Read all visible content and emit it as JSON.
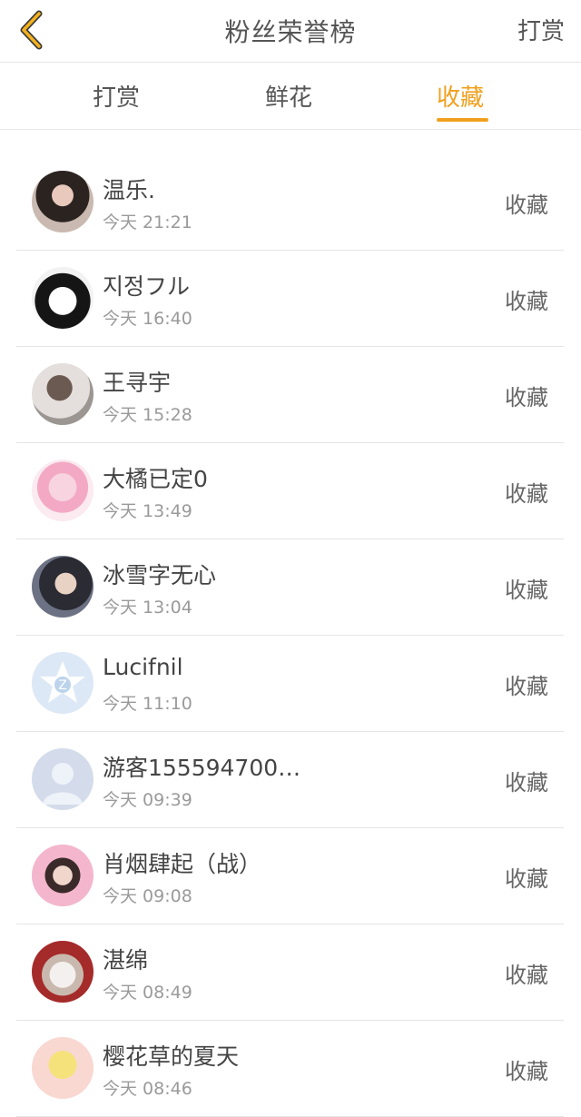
{
  "header": {
    "title": "粉丝荣誉榜",
    "action_label": "打赏"
  },
  "tabs": [
    {
      "label": "打赏",
      "active": false
    },
    {
      "label": "鲜花",
      "active": false
    },
    {
      "label": "收藏",
      "active": true
    }
  ],
  "accent_color": "#f0a01e",
  "list": [
    {
      "name": "温乐.",
      "time": "今天 21:21",
      "action": "收藏"
    },
    {
      "name": "지정フル",
      "time": "今天 16:40",
      "action": "收藏"
    },
    {
      "name": "王寻宇",
      "time": "今天 15:28",
      "action": "收藏"
    },
    {
      "name": "大橘已定0",
      "time": "今天 13:49",
      "action": "收藏"
    },
    {
      "name": "冰雪字无心",
      "time": "今天 13:04",
      "action": "收藏"
    },
    {
      "name": "Lucifnil",
      "time": "今天 11:10",
      "action": "收藏"
    },
    {
      "name": "游客155594700…",
      "time": "今天 09:39",
      "action": "收藏"
    },
    {
      "name": "肖烟肆起（战）",
      "time": "今天 09:08",
      "action": "收藏"
    },
    {
      "name": "湛绵",
      "time": "今天 08:49",
      "action": "收藏"
    },
    {
      "name": "樱花草的夏天",
      "time": "今天 08:46",
      "action": "收藏"
    }
  ]
}
